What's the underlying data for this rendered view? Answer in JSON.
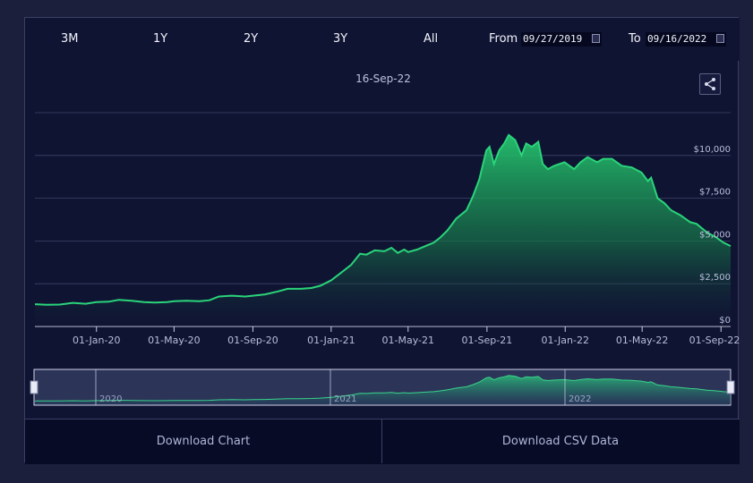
{
  "range_buttons": [
    "3M",
    "1Y",
    "2Y",
    "3Y",
    "All"
  ],
  "date_range": {
    "from_label": "From",
    "from_value": "09/27/2019",
    "to_label": "To",
    "to_value": "09/16/2022"
  },
  "hover_date": "16-Sep-22",
  "navigator": {
    "year_labels": [
      "2020",
      "2021",
      "2022"
    ]
  },
  "downloads": {
    "chart_label": "Download Chart",
    "csv_label": "Download CSV Data"
  },
  "colors": {
    "line": "#2ad47a",
    "background": "#101433",
    "grid": "#3d4266",
    "tick_text": "#b8bedb"
  },
  "icons": {
    "share": "share-icon",
    "calendar": "calendar-icon"
  },
  "chart_data": {
    "type": "area",
    "title": "",
    "xlabel": "",
    "ylabel": "",
    "x_ticks": [
      "01-Jan-20",
      "01-May-20",
      "01-Sep-20",
      "01-Jan-21",
      "01-May-21",
      "01-Sep-21",
      "01-Jan-22",
      "01-May-22",
      "01-Sep-22"
    ],
    "y_ticks": [
      "$0",
      "$2,500",
      "$5,000",
      "$7,500",
      "$10,000"
    ],
    "ylim": [
      0,
      12500
    ],
    "xlim": [
      "2019-09-27",
      "2022-09-16"
    ],
    "grid": true,
    "series": [
      {
        "points": [
          [
            "2019-09-27",
            1300
          ],
          [
            "2019-10-15",
            1270
          ],
          [
            "2019-11-05",
            1280
          ],
          [
            "2019-11-25",
            1380
          ],
          [
            "2019-12-15",
            1330
          ],
          [
            "2020-01-01",
            1420
          ],
          [
            "2020-01-20",
            1450
          ],
          [
            "2020-02-05",
            1560
          ],
          [
            "2020-02-25",
            1500
          ],
          [
            "2020-03-15",
            1420
          ],
          [
            "2020-04-01",
            1400
          ],
          [
            "2020-04-20",
            1430
          ],
          [
            "2020-05-01",
            1480
          ],
          [
            "2020-05-20",
            1500
          ],
          [
            "2020-06-10",
            1480
          ],
          [
            "2020-06-25",
            1530
          ],
          [
            "2020-07-10",
            1750
          ],
          [
            "2020-07-30",
            1800
          ],
          [
            "2020-08-20",
            1750
          ],
          [
            "2020-09-01",
            1800
          ],
          [
            "2020-09-20",
            1880
          ],
          [
            "2020-10-10",
            2050
          ],
          [
            "2020-10-25",
            2200
          ],
          [
            "2020-11-15",
            2200
          ],
          [
            "2020-12-01",
            2250
          ],
          [
            "2020-12-15",
            2380
          ],
          [
            "2021-01-01",
            2700
          ],
          [
            "2021-01-15",
            3100
          ],
          [
            "2021-02-01",
            3600
          ],
          [
            "2021-02-15",
            4250
          ],
          [
            "2021-02-25",
            4200
          ],
          [
            "2021-03-10",
            4450
          ],
          [
            "2021-03-25",
            4400
          ],
          [
            "2021-04-05",
            4600
          ],
          [
            "2021-04-15",
            4300
          ],
          [
            "2021-04-25",
            4500
          ],
          [
            "2021-05-01",
            4350
          ],
          [
            "2021-05-15",
            4500
          ],
          [
            "2021-05-31",
            4750
          ],
          [
            "2021-06-10",
            4900
          ],
          [
            "2021-06-20",
            5200
          ],
          [
            "2021-07-01",
            5600
          ],
          [
            "2021-07-15",
            6300
          ],
          [
            "2021-07-31",
            6800
          ],
          [
            "2021-08-10",
            7600
          ],
          [
            "2021-08-20",
            8600
          ],
          [
            "2021-08-31",
            10300
          ],
          [
            "2021-09-05",
            10500
          ],
          [
            "2021-09-12",
            9500
          ],
          [
            "2021-09-20",
            10300
          ],
          [
            "2021-09-28",
            10700
          ],
          [
            "2021-10-05",
            11200
          ],
          [
            "2021-10-15",
            10900
          ],
          [
            "2021-10-25",
            10000
          ],
          [
            "2021-11-01",
            10700
          ],
          [
            "2021-11-10",
            10500
          ],
          [
            "2021-11-20",
            10800
          ],
          [
            "2021-11-27",
            9500
          ],
          [
            "2021-12-05",
            9200
          ],
          [
            "2021-12-15",
            9400
          ],
          [
            "2021-12-31",
            9600
          ],
          [
            "2022-01-15",
            9200
          ],
          [
            "2022-01-25",
            9600
          ],
          [
            "2022-02-05",
            9900
          ],
          [
            "2022-02-20",
            9600
          ],
          [
            "2022-03-01",
            9800
          ],
          [
            "2022-03-15",
            9800
          ],
          [
            "2022-03-30",
            9400
          ],
          [
            "2022-04-15",
            9300
          ],
          [
            "2022-04-30",
            9000
          ],
          [
            "2022-05-10",
            8500
          ],
          [
            "2022-05-15",
            8700
          ],
          [
            "2022-05-25",
            7500
          ],
          [
            "2022-06-05",
            7200
          ],
          [
            "2022-06-15",
            6800
          ],
          [
            "2022-06-30",
            6500
          ],
          [
            "2022-07-15",
            6100
          ],
          [
            "2022-07-25",
            6000
          ],
          [
            "2022-08-10",
            5500
          ],
          [
            "2022-08-25",
            5200
          ],
          [
            "2022-09-05",
            4900
          ],
          [
            "2022-09-16",
            4700
          ]
        ]
      }
    ]
  }
}
